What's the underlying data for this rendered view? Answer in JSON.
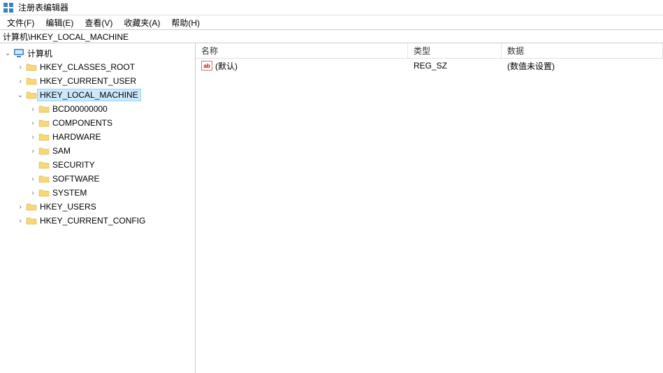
{
  "title": "注册表编辑器",
  "menu": {
    "file": "文件(F)",
    "edit": "编辑(E)",
    "view": "查看(V)",
    "favorites": "收藏夹(A)",
    "help": "帮助(H)"
  },
  "address": "计算机\\HKEY_LOCAL_MACHINE",
  "tree": {
    "root": "计算机",
    "hkcr": "HKEY_CLASSES_ROOT",
    "hkcu": "HKEY_CURRENT_USER",
    "hklm": "HKEY_LOCAL_MACHINE",
    "hklm_children": {
      "bcd": "BCD00000000",
      "components": "COMPONENTS",
      "hardware": "HARDWARE",
      "sam": "SAM",
      "security": "SECURITY",
      "software": "SOFTWARE",
      "system": "SYSTEM"
    },
    "hku": "HKEY_USERS",
    "hkcc": "HKEY_CURRENT_CONFIG"
  },
  "columns": {
    "name": "名称",
    "type": "类型",
    "data": "数据"
  },
  "values": [
    {
      "name": "(默认)",
      "type": "REG_SZ",
      "data": "(数值未设置)"
    }
  ]
}
